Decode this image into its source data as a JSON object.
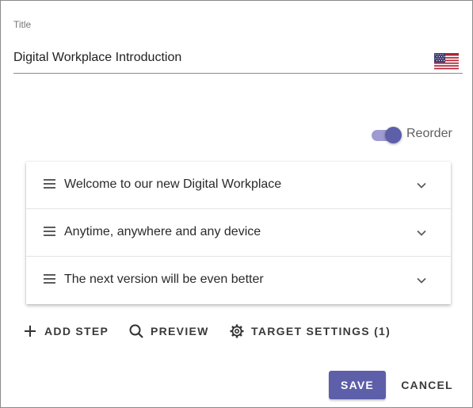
{
  "title_field": {
    "label": "Title",
    "value": "Digital Workplace Introduction",
    "language_icon": "us-flag-icon"
  },
  "reorder": {
    "label": "Reorder",
    "enabled": true
  },
  "steps": [
    {
      "label": "Welcome to our new Digital Workplace"
    },
    {
      "label": "Anytime, anywhere and any device"
    },
    {
      "label": "The next version will be even better"
    }
  ],
  "actions": {
    "add_step": "ADD STEP",
    "preview": "PREVIEW",
    "target_settings": "TARGET SETTINGS (1)"
  },
  "footer": {
    "save": "SAVE",
    "cancel": "CANCEL"
  },
  "colors": {
    "accent": "#5d5fa9",
    "toggle_track": "#9d9bd1"
  }
}
